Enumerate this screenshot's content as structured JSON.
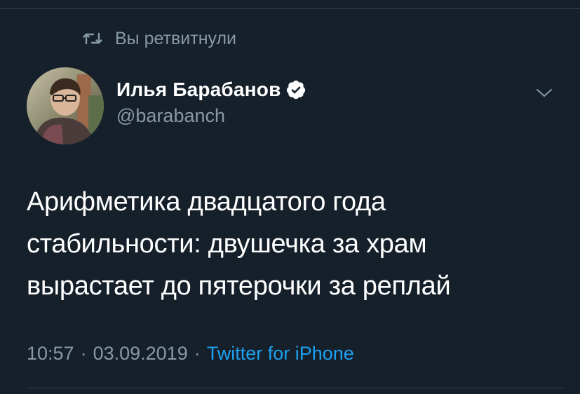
{
  "retweet": {
    "icon": "retweet-icon",
    "label": "Вы ретвитнули"
  },
  "author": {
    "display_name": "Илья Барабанов",
    "handle": "@barabanch",
    "verified": true,
    "verified_icon": "verified-badge-icon",
    "avatar_icon": "user-avatar"
  },
  "menu": {
    "icon": "chevron-down-icon"
  },
  "tweet": {
    "lines": [
      "Арифметика двадцатого года",
      "стабильности: двушечка за храм",
      "вырастает до пятерочки за реплай"
    ]
  },
  "meta": {
    "time": "10:57",
    "separator": "·",
    "date": "03.09.2019",
    "source": "Twitter for iPhone"
  },
  "colors": {
    "background": "#15202b",
    "secondary_text": "#8899a6",
    "link": "#1da1f2",
    "divider": "#38444d"
  }
}
